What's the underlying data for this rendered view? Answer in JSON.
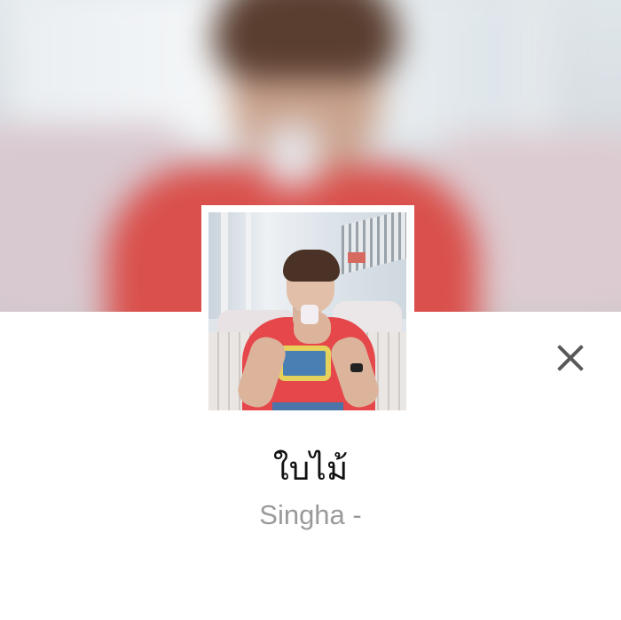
{
  "song": {
    "title": "ใบไม้",
    "artist": "Singha -"
  },
  "header": {
    "background": "blurred-album-art"
  },
  "album_art": {
    "description": "album-cover"
  },
  "close_button": {
    "icon": "close-icon"
  },
  "colors": {
    "title_text": "#111111",
    "artist_text": "#9a9a9a",
    "close_icon": "#595959",
    "sheet_background": "#ffffff"
  }
}
